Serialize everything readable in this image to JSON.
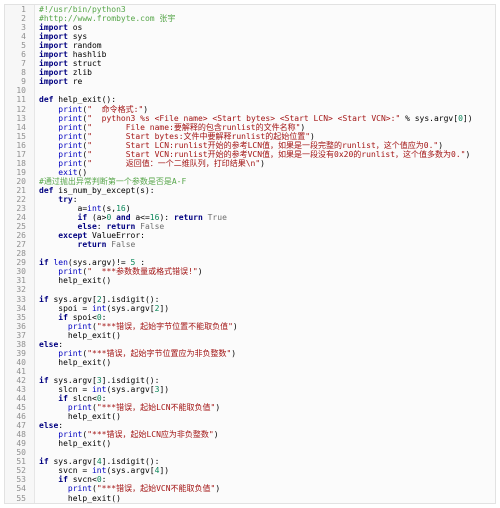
{
  "editor": {
    "title": "",
    "colors": {
      "comment": "#57a64a",
      "keyword": "#000080",
      "string": "#a31515",
      "number": "#098658",
      "builtin": "#0000c0",
      "constant": "#6d6d6d",
      "line_number": "#8f8f8f"
    },
    "lines": [
      {
        "n": "1",
        "segs": [
          {
            "t": "#!/usr/bin/python3",
            "c": "cm"
          }
        ]
      },
      {
        "n": "2",
        "segs": [
          {
            "t": "#http://www.frombyte.com 张宇",
            "c": "cm"
          }
        ]
      },
      {
        "n": "3",
        "segs": [
          {
            "t": "import",
            "c": "kw"
          },
          {
            "t": " os",
            "c": "pl"
          }
        ]
      },
      {
        "n": "4",
        "segs": [
          {
            "t": "import",
            "c": "kw"
          },
          {
            "t": " sys",
            "c": "pl"
          }
        ]
      },
      {
        "n": "5",
        "segs": [
          {
            "t": "import",
            "c": "kw"
          },
          {
            "t": " random",
            "c": "pl"
          }
        ]
      },
      {
        "n": "6",
        "segs": [
          {
            "t": "import",
            "c": "kw"
          },
          {
            "t": " hashlib",
            "c": "pl"
          }
        ]
      },
      {
        "n": "7",
        "segs": [
          {
            "t": "import",
            "c": "kw"
          },
          {
            "t": " struct",
            "c": "pl"
          }
        ]
      },
      {
        "n": "8",
        "segs": [
          {
            "t": "import",
            "c": "kw"
          },
          {
            "t": " zlib",
            "c": "pl"
          }
        ]
      },
      {
        "n": "9",
        "segs": [
          {
            "t": "import",
            "c": "kw"
          },
          {
            "t": " re",
            "c": "pl"
          }
        ]
      },
      {
        "n": "10",
        "segs": [
          {
            "t": "",
            "c": "pl"
          }
        ]
      },
      {
        "n": "11",
        "segs": [
          {
            "t": "def",
            "c": "kw"
          },
          {
            "t": " help_exit():",
            "c": "pl"
          }
        ]
      },
      {
        "n": "12",
        "segs": [
          {
            "t": "    print",
            "c": "bi"
          },
          {
            "t": "(",
            "c": "pl"
          },
          {
            "t": "\"  命令格式:\"",
            "c": "st"
          },
          {
            "t": ")",
            "c": "pl"
          }
        ]
      },
      {
        "n": "13",
        "segs": [
          {
            "t": "    print",
            "c": "bi"
          },
          {
            "t": "(",
            "c": "pl"
          },
          {
            "t": "\"  python3 %s <File name> <Start bytes> <Start LCN> <Start VCN>:\"",
            "c": "st"
          },
          {
            "t": " % sys.argv[",
            "c": "pl"
          },
          {
            "t": "0",
            "c": "nm"
          },
          {
            "t": "])",
            "c": "pl"
          }
        ]
      },
      {
        "n": "14",
        "segs": [
          {
            "t": "    print",
            "c": "bi"
          },
          {
            "t": "(",
            "c": "pl"
          },
          {
            "t": "\"       File name:要解释的包含runlist的文件名称\"",
            "c": "st"
          },
          {
            "t": ")",
            "c": "pl"
          }
        ]
      },
      {
        "n": "15",
        "segs": [
          {
            "t": "    print",
            "c": "bi"
          },
          {
            "t": "(",
            "c": "pl"
          },
          {
            "t": "\"       Start bytes:文件中要解释runlist的起始位置\"",
            "c": "st"
          },
          {
            "t": ")",
            "c": "pl"
          }
        ]
      },
      {
        "n": "16",
        "segs": [
          {
            "t": "    print",
            "c": "bi"
          },
          {
            "t": "(",
            "c": "pl"
          },
          {
            "t": "\"       Start LCN:runlist开始的参考LCN值，如果是一段完整的runlist，这个值应为0.\"",
            "c": "st"
          },
          {
            "t": ")",
            "c": "pl"
          }
        ]
      },
      {
        "n": "17",
        "segs": [
          {
            "t": "    print",
            "c": "bi"
          },
          {
            "t": "(",
            "c": "pl"
          },
          {
            "t": "\"       Start VCN:runlist开始的参考VCN值，如果是一段没有0x20的runlist，这个值多数为0.\"",
            "c": "st"
          },
          {
            "t": ")",
            "c": "pl"
          }
        ]
      },
      {
        "n": "18",
        "segs": [
          {
            "t": "    print",
            "c": "bi"
          },
          {
            "t": "(",
            "c": "pl"
          },
          {
            "t": "\"       返回值：一个二维队列，打印结果\\n\"",
            "c": "st"
          },
          {
            "t": ")",
            "c": "pl"
          }
        ]
      },
      {
        "n": "19",
        "segs": [
          {
            "t": "    exit",
            "c": "bi"
          },
          {
            "t": "()",
            "c": "pl"
          }
        ]
      },
      {
        "n": "20",
        "segs": [
          {
            "t": "#通过抛出异常判断第一个参数是否是A-F",
            "c": "cm"
          }
        ]
      },
      {
        "n": "21",
        "segs": [
          {
            "t": "def",
            "c": "kw"
          },
          {
            "t": " is_num_by_except(s):",
            "c": "pl"
          }
        ]
      },
      {
        "n": "22",
        "segs": [
          {
            "t": "    try",
            "c": "kw"
          },
          {
            "t": ":",
            "c": "pl"
          }
        ]
      },
      {
        "n": "23",
        "segs": [
          {
            "t": "        a=",
            "c": "pl"
          },
          {
            "t": "int",
            "c": "bi"
          },
          {
            "t": "(s,",
            "c": "pl"
          },
          {
            "t": "16",
            "c": "nm"
          },
          {
            "t": ")",
            "c": "pl"
          }
        ]
      },
      {
        "n": "24",
        "segs": [
          {
            "t": "        if",
            "c": "kw"
          },
          {
            "t": " (a>",
            "c": "pl"
          },
          {
            "t": "0",
            "c": "nm"
          },
          {
            "t": " and",
            "c": "kw"
          },
          {
            "t": " a<=",
            "c": "pl"
          },
          {
            "t": "16",
            "c": "nm"
          },
          {
            "t": "): ",
            "c": "pl"
          },
          {
            "t": "return",
            "c": "kw"
          },
          {
            "t": " True",
            "c": "cn"
          }
        ]
      },
      {
        "n": "25",
        "segs": [
          {
            "t": "        else",
            "c": "kw"
          },
          {
            "t": ": ",
            "c": "pl"
          },
          {
            "t": "return",
            "c": "kw"
          },
          {
            "t": " False",
            "c": "cn"
          }
        ]
      },
      {
        "n": "26",
        "segs": [
          {
            "t": "    except",
            "c": "kw"
          },
          {
            "t": " ValueError:",
            "c": "pl"
          }
        ]
      },
      {
        "n": "27",
        "segs": [
          {
            "t": "        return",
            "c": "kw"
          },
          {
            "t": " False",
            "c": "cn"
          }
        ]
      },
      {
        "n": "28",
        "segs": [
          {
            "t": "",
            "c": "pl"
          }
        ]
      },
      {
        "n": "29",
        "segs": [
          {
            "t": "if",
            "c": "kw"
          },
          {
            "t": " ",
            "c": "pl"
          },
          {
            "t": "len",
            "c": "bi"
          },
          {
            "t": "(sys.argv)!= ",
            "c": "pl"
          },
          {
            "t": "5",
            "c": "nm"
          },
          {
            "t": " :",
            "c": "pl"
          }
        ]
      },
      {
        "n": "30",
        "segs": [
          {
            "t": "    print",
            "c": "bi"
          },
          {
            "t": "(",
            "c": "pl"
          },
          {
            "t": "\"  ***参数数量或格式错误!\"",
            "c": "st"
          },
          {
            "t": ")",
            "c": "pl"
          }
        ]
      },
      {
        "n": "31",
        "segs": [
          {
            "t": "    help_exit()",
            "c": "pl"
          }
        ]
      },
      {
        "n": "32",
        "segs": [
          {
            "t": "",
            "c": "pl"
          }
        ]
      },
      {
        "n": "33",
        "segs": [
          {
            "t": "if",
            "c": "kw"
          },
          {
            "t": " sys.argv[",
            "c": "pl"
          },
          {
            "t": "2",
            "c": "nm"
          },
          {
            "t": "].isdigit():",
            "c": "pl"
          }
        ]
      },
      {
        "n": "34",
        "segs": [
          {
            "t": "    spoi = ",
            "c": "pl"
          },
          {
            "t": "int",
            "c": "bi"
          },
          {
            "t": "(sys.argv[",
            "c": "pl"
          },
          {
            "t": "2",
            "c": "nm"
          },
          {
            "t": "])",
            "c": "pl"
          }
        ]
      },
      {
        "n": "35",
        "segs": [
          {
            "t": "    if",
            "c": "kw"
          },
          {
            "t": " spoi<",
            "c": "pl"
          },
          {
            "t": "0",
            "c": "nm"
          },
          {
            "t": ":",
            "c": "pl"
          }
        ]
      },
      {
        "n": "36",
        "segs": [
          {
            "t": "      print",
            "c": "bi"
          },
          {
            "t": "(",
            "c": "pl"
          },
          {
            "t": "\"***错误，起始字节位置不能取负值\"",
            "c": "st"
          },
          {
            "t": ")",
            "c": "pl"
          }
        ]
      },
      {
        "n": "37",
        "segs": [
          {
            "t": "      help_exit()",
            "c": "pl"
          }
        ]
      },
      {
        "n": "38",
        "segs": [
          {
            "t": "else",
            "c": "kw"
          },
          {
            "t": ":",
            "c": "pl"
          }
        ]
      },
      {
        "n": "39",
        "segs": [
          {
            "t": "    print",
            "c": "bi"
          },
          {
            "t": "(",
            "c": "pl"
          },
          {
            "t": "\"***错误，起始字节位置应为非负整数\"",
            "c": "st"
          },
          {
            "t": ")",
            "c": "pl"
          }
        ]
      },
      {
        "n": "40",
        "segs": [
          {
            "t": "    help_exit()",
            "c": "pl"
          }
        ]
      },
      {
        "n": "41",
        "segs": [
          {
            "t": "",
            "c": "pl"
          }
        ]
      },
      {
        "n": "42",
        "segs": [
          {
            "t": "if",
            "c": "kw"
          },
          {
            "t": " sys.argv[",
            "c": "pl"
          },
          {
            "t": "3",
            "c": "nm"
          },
          {
            "t": "].isdigit():",
            "c": "pl"
          }
        ]
      },
      {
        "n": "43",
        "segs": [
          {
            "t": "    slcn = ",
            "c": "pl"
          },
          {
            "t": "int",
            "c": "bi"
          },
          {
            "t": "(sys.argv[",
            "c": "pl"
          },
          {
            "t": "3",
            "c": "nm"
          },
          {
            "t": "])",
            "c": "pl"
          }
        ]
      },
      {
        "n": "44",
        "segs": [
          {
            "t": "    if",
            "c": "kw"
          },
          {
            "t": " slcn<",
            "c": "pl"
          },
          {
            "t": "0",
            "c": "nm"
          },
          {
            "t": ":",
            "c": "pl"
          }
        ]
      },
      {
        "n": "45",
        "segs": [
          {
            "t": "      print",
            "c": "bi"
          },
          {
            "t": "(",
            "c": "pl"
          },
          {
            "t": "\"***错误，起始LCN不能取负值\"",
            "c": "st"
          },
          {
            "t": ")",
            "c": "pl"
          }
        ]
      },
      {
        "n": "46",
        "segs": [
          {
            "t": "      help_exit()",
            "c": "pl"
          }
        ]
      },
      {
        "n": "47",
        "segs": [
          {
            "t": "else",
            "c": "kw"
          },
          {
            "t": ":",
            "c": "pl"
          }
        ]
      },
      {
        "n": "48",
        "segs": [
          {
            "t": "    print",
            "c": "bi"
          },
          {
            "t": "(",
            "c": "pl"
          },
          {
            "t": "\"***错误，起始LCN应为非负整数\"",
            "c": "st"
          },
          {
            "t": ")",
            "c": "pl"
          }
        ]
      },
      {
        "n": "49",
        "segs": [
          {
            "t": "    help_exit()",
            "c": "pl"
          }
        ]
      },
      {
        "n": "50",
        "segs": [
          {
            "t": "",
            "c": "pl"
          }
        ]
      },
      {
        "n": "51",
        "segs": [
          {
            "t": "if",
            "c": "kw"
          },
          {
            "t": " sys.argv[",
            "c": "pl"
          },
          {
            "t": "4",
            "c": "nm"
          },
          {
            "t": "].isdigit():",
            "c": "pl"
          }
        ]
      },
      {
        "n": "52",
        "segs": [
          {
            "t": "    svcn = ",
            "c": "pl"
          },
          {
            "t": "int",
            "c": "bi"
          },
          {
            "t": "(sys.argv[",
            "c": "pl"
          },
          {
            "t": "4",
            "c": "nm"
          },
          {
            "t": "])",
            "c": "pl"
          }
        ]
      },
      {
        "n": "53",
        "segs": [
          {
            "t": "    if",
            "c": "kw"
          },
          {
            "t": " svcn<",
            "c": "pl"
          },
          {
            "t": "0",
            "c": "nm"
          },
          {
            "t": ":",
            "c": "pl"
          }
        ]
      },
      {
        "n": "54",
        "segs": [
          {
            "t": "      print",
            "c": "bi"
          },
          {
            "t": "(",
            "c": "pl"
          },
          {
            "t": "\"***错误，起始VCN不能取负值\"",
            "c": "st"
          },
          {
            "t": ")",
            "c": "pl"
          }
        ]
      },
      {
        "n": "55",
        "segs": [
          {
            "t": "      help_exit()",
            "c": "pl"
          }
        ]
      }
    ]
  }
}
